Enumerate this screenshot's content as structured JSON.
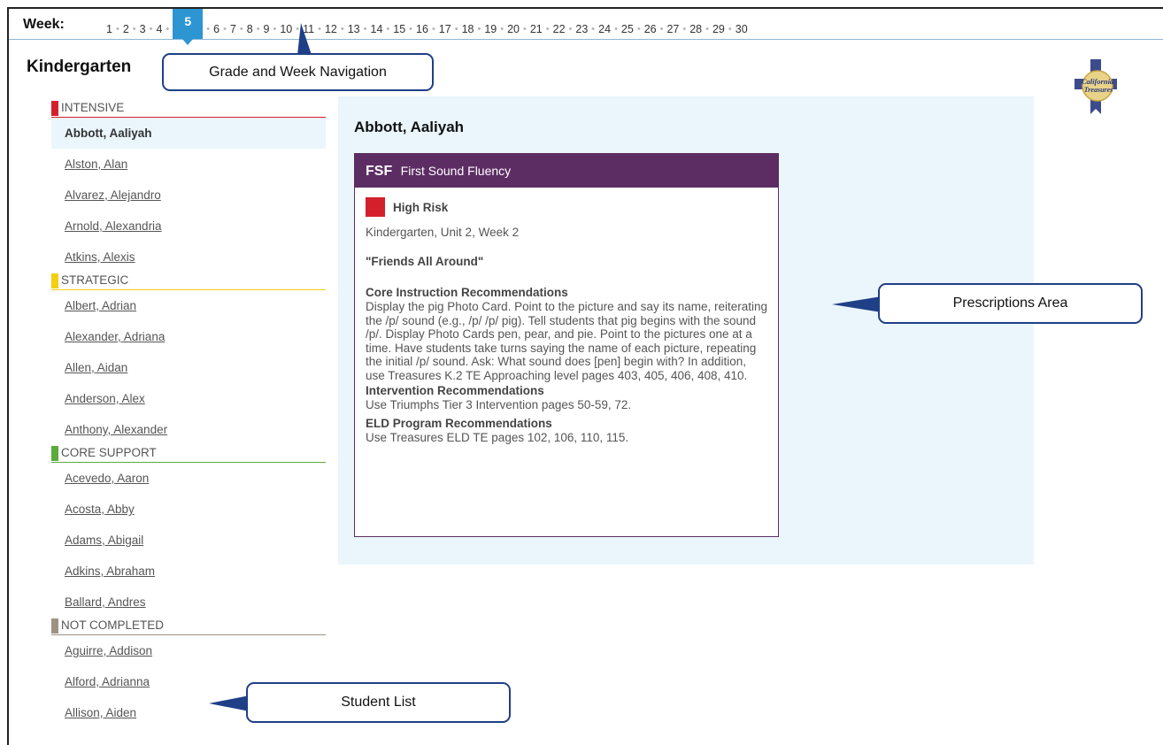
{
  "week_nav": {
    "label": "Week:",
    "weeks": [
      "1",
      "2",
      "3",
      "4",
      "5",
      "6",
      "7",
      "8",
      "9",
      "10",
      "11",
      "12",
      "13",
      "14",
      "15",
      "16",
      "17",
      "18",
      "19",
      "20",
      "21",
      "22",
      "23",
      "24",
      "25",
      "26",
      "27",
      "28",
      "29",
      "30"
    ],
    "current": "5"
  },
  "grade": "Kindergarten",
  "logo": {
    "line1": "California",
    "line2": "Treasures"
  },
  "groups": [
    {
      "name": "INTENSIVE",
      "color": "#d4202b",
      "students": [
        "Abbott, Aaliyah",
        "Alston, Alan",
        "Alvarez, Alejandro",
        "Arnold, Alexandria",
        "Atkins, Alexis"
      ]
    },
    {
      "name": "STRATEGIC",
      "color": "#f2cf12",
      "students": [
        "Albert, Adrian",
        "Alexander, Adriana",
        "Allen, Aidan",
        "Anderson, Alex",
        "Anthony, Alexander"
      ]
    },
    {
      "name": "CORE SUPPORT",
      "color": "#5aab3c",
      "students": [
        "Acevedo, Aaron",
        "Acosta, Abby",
        "Adams, Abigail",
        "Adkins, Abraham",
        "Ballard, Andres"
      ]
    },
    {
      "name": "NOT COMPLETED",
      "color": "#9e9284",
      "students": [
        "Aguirre, Addison",
        "Alford, Adrianna",
        "Allison, Aiden"
      ]
    }
  ],
  "selected_student": "Abbott, Aaliyah",
  "prescription": {
    "student": "Abbott, Aaliyah",
    "code": "FSF",
    "measure": "First Sound Fluency",
    "header_color": "#5c2d63",
    "risk": "High Risk",
    "risk_color": "#d4202b",
    "unit_week": "Kindergarten, Unit 2, Week 2",
    "story": "\"Friends All Around\"",
    "core_title": "Core Instruction Recommendations",
    "core_text": "Display the pig Photo Card. Point to the picture and say its name, reiterating the /p/ sound (e.g., /p/ /p/ pig). Tell students that pig begins with the sound /p/. Display Photo Cards pen, pear, and pie. Point to the pictures one at a time. Have students take turns saying the name of each picture, repeating the initial /p/ sound. Ask: What sound does [pen] begin with? In addition, use Treasures K.2 TE Approaching level pages 403, 405, 406, 408, 410.",
    "intervention_title": "Intervention Recommendations",
    "intervention_text": "Use Triumphs Tier 3 Intervention pages 50-59, 72.",
    "eld_title": "ELD Program Recommendations",
    "eld_text": "Use Treasures ELD TE pages 102, 106, 110, 115."
  },
  "callouts": {
    "nav": "Grade and Week Navigation",
    "prescriptions": "Prescriptions Area",
    "student_list": "Student List"
  }
}
